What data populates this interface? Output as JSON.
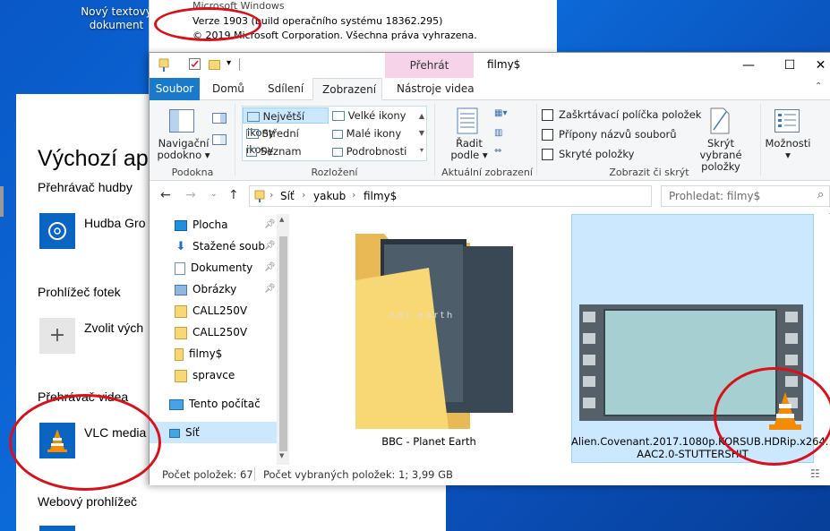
{
  "desktop": {
    "icon_label": "Nový textový dokument"
  },
  "about_window": {
    "product": "Microsoft Windows",
    "version": "Verze 1903 (build operačního systému 18362.295)",
    "copyright": "© 2019 Microsoft Corporation. Všechna práva vyhrazena."
  },
  "settings": {
    "header": "Výchozí ap",
    "sections": [
      {
        "label": "Přehrávač hudby",
        "app": "Hudba Gro"
      },
      {
        "label": "Prohlížeč fotek",
        "app": "Zvolit vých"
      },
      {
        "label": "Přehrávač videa",
        "app": "VLC media"
      },
      {
        "label": "Webový prohlížeč",
        "app": ""
      }
    ]
  },
  "explorer": {
    "title": "filmy$",
    "context_tab": "Přehrát",
    "window_buttons": {
      "minimize": "—",
      "maximize": "☐",
      "close": "✕"
    },
    "ribbon_tabs": [
      "Soubor",
      "Domů",
      "Sdílení",
      "Zobrazení",
      "Nástroje videa"
    ],
    "ribbon": {
      "nav_pane_label1": "Navigační",
      "nav_pane_label2": "podokno",
      "group_panes": "Podokna",
      "layouts": [
        "Největší ikony",
        "Velké ikony",
        "Střední ikony",
        "Malé ikony",
        "Seznam",
        "Podrobnosti"
      ],
      "group_layout": "Rozložení",
      "sort_label1": "Řadit",
      "sort_label2": "podle",
      "group_current_view": "Aktuální zobrazení",
      "checkboxes": [
        "Zaškrtávací políčka položek",
        "Přípony názvů souborů",
        "Skryté položky"
      ],
      "hide_selected1": "Skrýt vybrané",
      "hide_selected2": "položky",
      "group_show_hide": "Zobrazit či skrýt",
      "options": "Možnosti"
    },
    "breadcrumb": [
      "Síť",
      "yakub",
      "filmy$"
    ],
    "search_placeholder": "Prohledat: filmy$",
    "nav_items": [
      {
        "label": "Plocha",
        "pinned": true
      },
      {
        "label": "Stažené soub",
        "pinned": true
      },
      {
        "label": "Dokumenty",
        "pinned": true
      },
      {
        "label": "Obrázky",
        "pinned": true
      },
      {
        "label": "CALL250V",
        "pinned": false
      },
      {
        "label": "CALL250V",
        "pinned": false
      },
      {
        "label": "filmy$",
        "pinned": false
      },
      {
        "label": "spravce",
        "pinned": false
      },
      {
        "label": "Tento počítač",
        "pinned": false
      },
      {
        "label": "Síť",
        "pinned": false
      }
    ],
    "items": [
      {
        "name": "BBC - Planet Earth",
        "overlay_text": "net earth"
      },
      {
        "name": "Alien.Covenant.2017.1080p.KORSUB.HDRip.x264.AAC2.0-STUTTERSHIT",
        "line1": "Alien.Covenant.2017.1080p.KORSUB.HDRip.x264.",
        "line2": "AAC2.0-STUTTERSHIT"
      }
    ],
    "status": {
      "count": "Počet položek: 67",
      "selected": "Počet vybraných položek: 1; 3,99 GB"
    }
  },
  "colors": {
    "file_tab": "#1979ca",
    "context_tab": "#f7d3ea",
    "selection": "#cce8ff",
    "annotation": "#d8111b"
  }
}
